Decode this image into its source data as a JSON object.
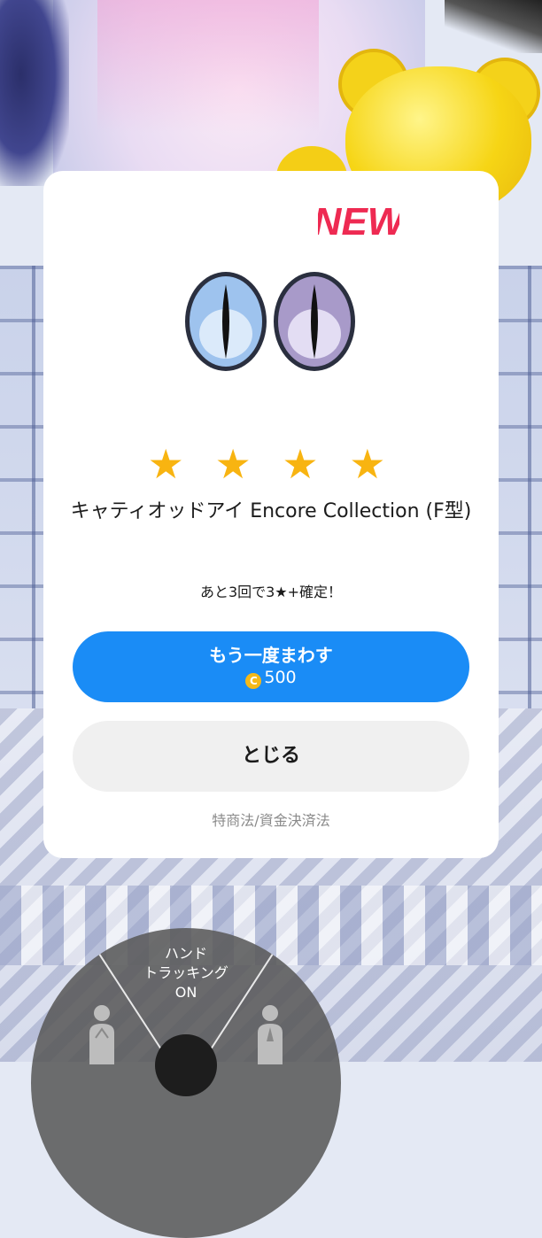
{
  "result_dialog": {
    "badge": "NEW",
    "rarity_stars": [
      "★",
      "★",
      "★",
      "★"
    ],
    "item_name": "キャティオッドアイ Encore Collection (F型)",
    "guarantee_text": "あと3回で3★+確定！",
    "spin_again": {
      "label": "もう一度まわす",
      "coin_symbol": "C",
      "cost": "500"
    },
    "close_label": "とじる",
    "legal_link": "特商法/資金決済法"
  },
  "hand_tracking_menu": {
    "label_lines": [
      "ハンド",
      "トラッキング",
      "ON"
    ]
  },
  "colors": {
    "primary_button": "#1a8cf6",
    "star": "#f8b411",
    "new_badge": "#ee2a52",
    "coin": "#f5b919"
  },
  "icons": {
    "lens_left": "blue-cat-eye-lens-icon",
    "lens_right": "purple-cat-eye-lens-icon",
    "coin": "coin-icon",
    "pose_left": "hands-clasped-pose-icon",
    "pose_right": "prayer-pose-icon"
  }
}
